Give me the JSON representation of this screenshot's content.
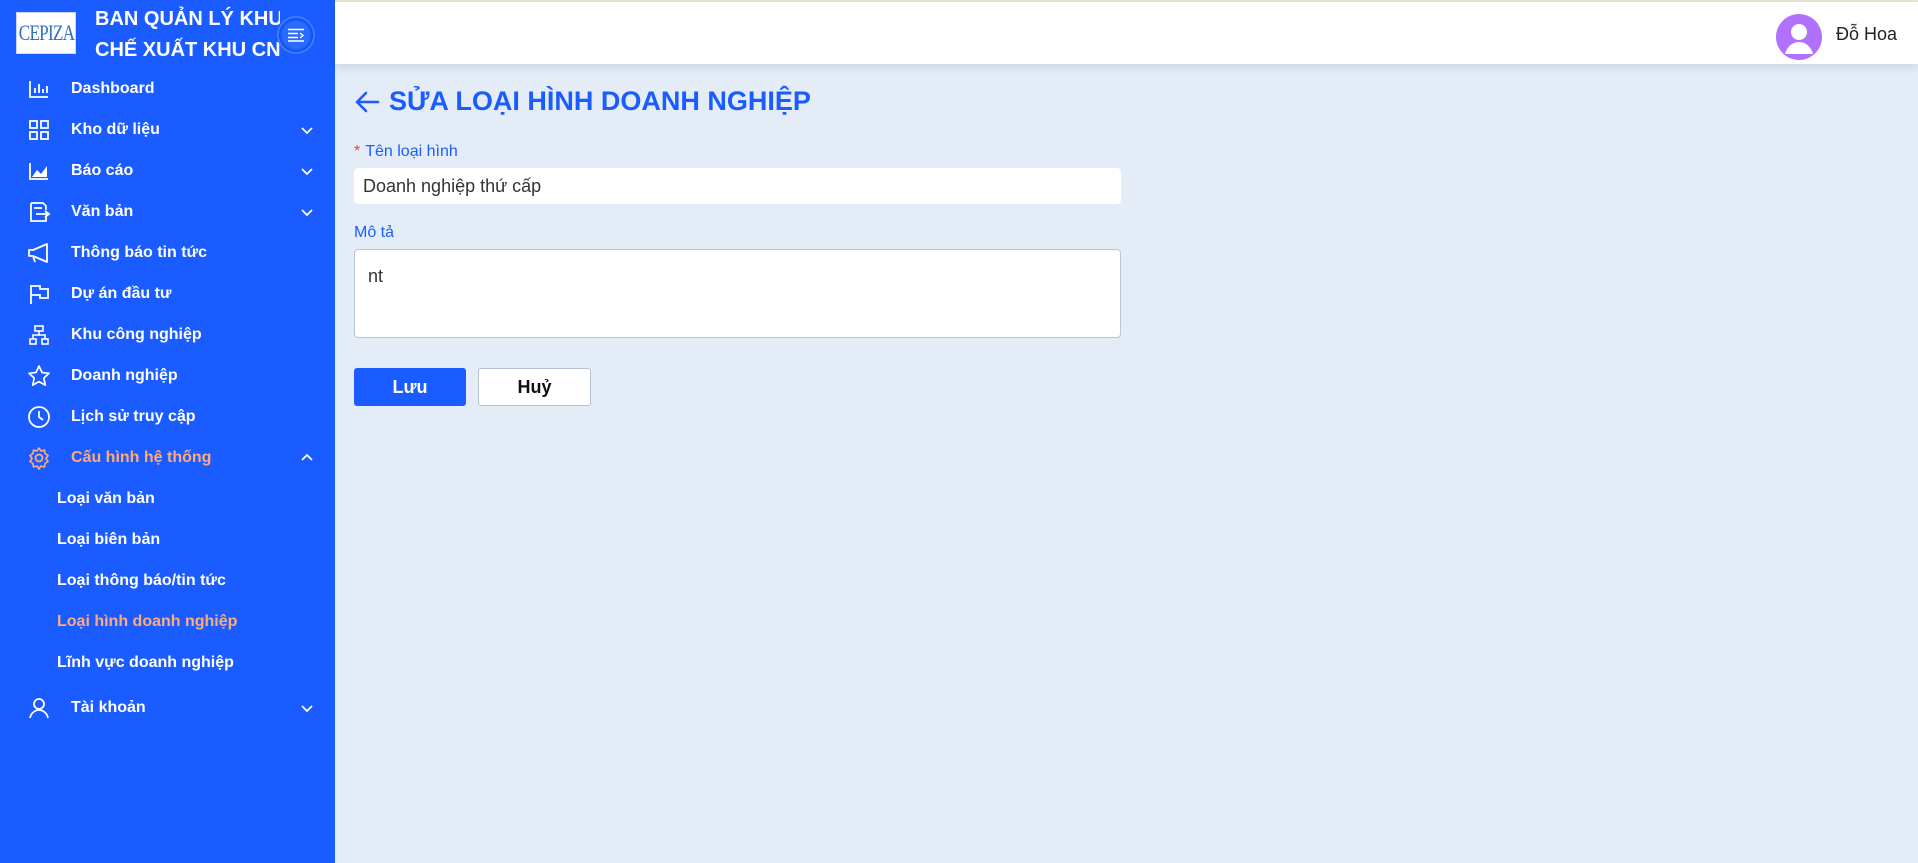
{
  "brand": {
    "logo_text": "CEPIZA",
    "title_line1": "BAN QUẢN LÝ KHU",
    "title_line2": "CHẾ XUẤT KHU CN"
  },
  "sidebar": {
    "items": [
      {
        "label": "Dashboard",
        "icon": "bar-chart-icon"
      },
      {
        "label": "Kho dữ liệu",
        "icon": "grid-icon"
      },
      {
        "label": "Báo cáo",
        "icon": "area-chart-icon"
      },
      {
        "label": "Văn bản",
        "icon": "document-icon"
      },
      {
        "label": "Thông báo tin tức",
        "icon": "megaphone-icon"
      },
      {
        "label": "Dự án đầu tư",
        "icon": "flag-icon"
      },
      {
        "label": "Khu công nghiệp",
        "icon": "cluster-icon"
      },
      {
        "label": "Doanh nghiệp",
        "icon": "star-icon"
      },
      {
        "label": "Lịch sử truy cập",
        "icon": "clock-icon"
      },
      {
        "label": "Cấu hình hệ thống",
        "icon": "gear-icon"
      },
      {
        "label": "Tài khoản",
        "icon": "user-icon"
      }
    ],
    "subitems": [
      {
        "label": "Loại văn bản"
      },
      {
        "label": "Loại biên bản"
      },
      {
        "label": "Loại thông báo/tin tức"
      },
      {
        "label": "Loại hình doanh nghiệp"
      },
      {
        "label": "Lĩnh vực doanh nghiệp"
      }
    ]
  },
  "header": {
    "username": "Đỗ Hoa"
  },
  "main": {
    "title": "SỬA LOẠI HÌNH DOANH NGHIỆP",
    "required_mark": "*",
    "name_label": "Tên loại hình",
    "name_value": "Doanh nghiệp thứ cấp",
    "desc_label": "Mô tả",
    "desc_value": "nt",
    "save_label": "Lưu",
    "cancel_label": "Huỷ"
  },
  "colors": {
    "primary": "#1a5cff",
    "active_menu": "#ffab7a",
    "background": "#e3ecf7",
    "avatar": "#b270ff",
    "required": "#ff3b30"
  }
}
